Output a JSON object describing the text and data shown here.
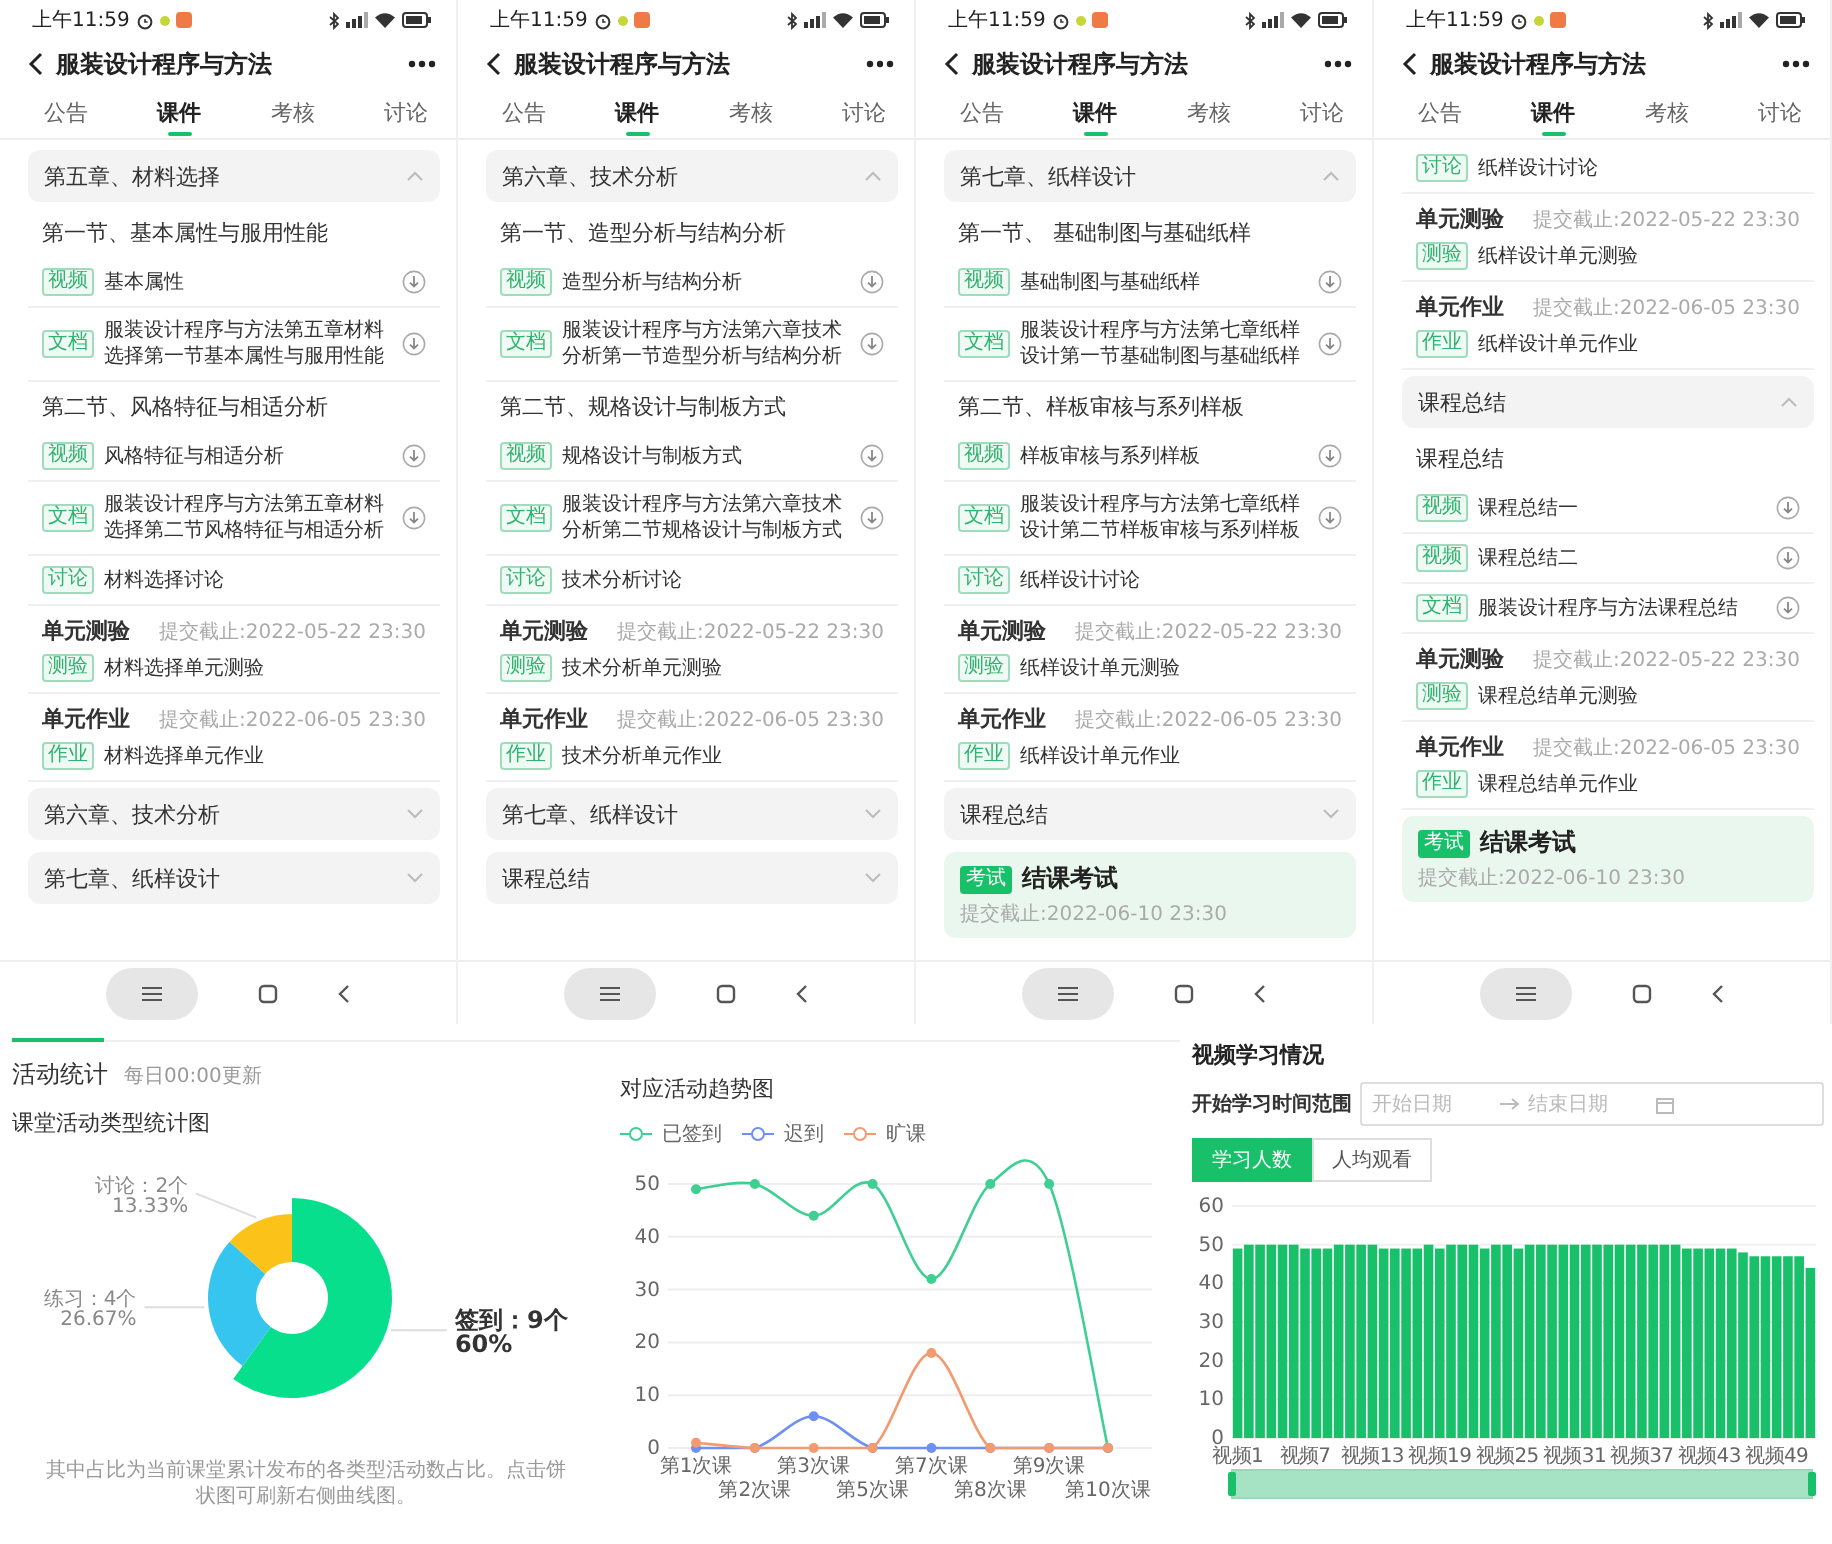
{
  "phones": [
    {
      "status_time": "上午11:59",
      "title": "服装设计程序与方法",
      "tabs": [
        {
          "label": "公告",
          "selected": false
        },
        {
          "label": "课件",
          "selected": true
        },
        {
          "label": "考核",
          "selected": false
        },
        {
          "label": "讨论",
          "selected": false
        }
      ],
      "items": [
        {
          "kind": "chapter",
          "title": "第五章、材料选择",
          "expanded": true
        },
        {
          "kind": "section",
          "title": "第一节、基本属性与服用性能"
        },
        {
          "kind": "resource",
          "tag": "视频",
          "text": "基本属性",
          "download": true
        },
        {
          "kind": "resource",
          "tag": "文档",
          "text": "服装设计程序与方法第五章材料选择第一节基本属性与服用性能",
          "download": true
        },
        {
          "kind": "section",
          "title": "第二节、风格特征与相适分析"
        },
        {
          "kind": "resource",
          "tag": "视频",
          "text": "风格特征与相适分析",
          "download": true
        },
        {
          "kind": "resource",
          "tag": "文档",
          "text": "服装设计程序与方法第五章材料选择第二节风格特征与相适分析",
          "download": true
        },
        {
          "kind": "resource",
          "tag": "讨论",
          "text": "材料选择讨论",
          "download": false
        },
        {
          "kind": "unit",
          "title": "单元测验",
          "deadline": "提交截止:2022-05-22 23:30",
          "tag": "测验",
          "text": "材料选择单元测验"
        },
        {
          "kind": "unit",
          "title": "单元作业",
          "deadline": "提交截止:2022-06-05 23:30",
          "tag": "作业",
          "text": "材料选择单元作业"
        },
        {
          "kind": "chapter",
          "title": "第六章、技术分析",
          "expanded": false
        },
        {
          "kind": "chapter",
          "title": "第七章、纸样设计",
          "expanded": false
        }
      ]
    },
    {
      "status_time": "上午11:59",
      "title": "服装设计程序与方法",
      "tabs": [
        {
          "label": "公告",
          "selected": false
        },
        {
          "label": "课件",
          "selected": true
        },
        {
          "label": "考核",
          "selected": false
        },
        {
          "label": "讨论",
          "selected": false
        }
      ],
      "items": [
        {
          "kind": "chapter",
          "title": "第六章、技术分析",
          "expanded": true
        },
        {
          "kind": "section",
          "title": "第一节、造型分析与结构分析"
        },
        {
          "kind": "resource",
          "tag": "视频",
          "text": "造型分析与结构分析",
          "download": true
        },
        {
          "kind": "resource",
          "tag": "文档",
          "text": "服装设计程序与方法第六章技术分析第一节造型分析与结构分析",
          "download": true
        },
        {
          "kind": "section",
          "title": "第二节、规格设计与制板方式"
        },
        {
          "kind": "resource",
          "tag": "视频",
          "text": "规格设计与制板方式",
          "download": true
        },
        {
          "kind": "resource",
          "tag": "文档",
          "text": "服装设计程序与方法第六章技术分析第二节规格设计与制板方式",
          "download": true
        },
        {
          "kind": "resource",
          "tag": "讨论",
          "text": "技术分析讨论",
          "download": false
        },
        {
          "kind": "unit",
          "title": "单元测验",
          "deadline": "提交截止:2022-05-22 23:30",
          "tag": "测验",
          "text": "技术分析单元测验"
        },
        {
          "kind": "unit",
          "title": "单元作业",
          "deadline": "提交截止:2022-06-05 23:30",
          "tag": "作业",
          "text": "技术分析单元作业"
        },
        {
          "kind": "chapter",
          "title": "第七章、纸样设计",
          "expanded": false
        },
        {
          "kind": "chapter",
          "title": "课程总结",
          "expanded": false
        }
      ]
    },
    {
      "status_time": "上午11:59",
      "title": "服装设计程序与方法",
      "tabs": [
        {
          "label": "公告",
          "selected": false
        },
        {
          "label": "课件",
          "selected": true
        },
        {
          "label": "考核",
          "selected": false
        },
        {
          "label": "讨论",
          "selected": false
        }
      ],
      "items": [
        {
          "kind": "chapter",
          "title": "第七章、纸样设计",
          "expanded": true
        },
        {
          "kind": "section",
          "title": "第一节、 基础制图与基础纸样"
        },
        {
          "kind": "resource",
          "tag": "视频",
          "text": "基础制图与基础纸样",
          "download": true
        },
        {
          "kind": "resource",
          "tag": "文档",
          "text": "服装设计程序与方法第七章纸样设计第一节基础制图与基础纸样",
          "download": true
        },
        {
          "kind": "section",
          "title": "第二节、样板审核与系列样板"
        },
        {
          "kind": "resource",
          "tag": "视频",
          "text": "样板审核与系列样板",
          "download": true
        },
        {
          "kind": "resource",
          "tag": "文档",
          "text": "服装设计程序与方法第七章纸样设计第二节样板审核与系列样板",
          "download": true
        },
        {
          "kind": "resource",
          "tag": "讨论",
          "text": "纸样设计讨论",
          "download": false
        },
        {
          "kind": "unit",
          "title": "单元测验",
          "deadline": "提交截止:2022-05-22 23:30",
          "tag": "测验",
          "text": "纸样设计单元测验"
        },
        {
          "kind": "unit",
          "title": "单元作业",
          "deadline": "提交截止:2022-06-05 23:30",
          "tag": "作业",
          "text": "纸样设计单元作业"
        },
        {
          "kind": "chapter",
          "title": "课程总结",
          "expanded": false
        },
        {
          "kind": "exam",
          "tag": "考试",
          "title": "结课考试",
          "deadline": "提交截止:2022-06-10 23:30"
        }
      ]
    },
    {
      "status_time": "上午11:59",
      "title": "服装设计程序与方法",
      "tabs": [
        {
          "label": "公告",
          "selected": false
        },
        {
          "label": "课件",
          "selected": true
        },
        {
          "label": "考核",
          "selected": false
        },
        {
          "label": "讨论",
          "selected": false
        }
      ],
      "items": [
        {
          "kind": "resource",
          "tag": "讨论",
          "text": "纸样设计讨论",
          "download": false
        },
        {
          "kind": "unit",
          "title": "单元测验",
          "deadline": "提交截止:2022-05-22 23:30",
          "tag": "测验",
          "text": "纸样设计单元测验"
        },
        {
          "kind": "unit",
          "title": "单元作业",
          "deadline": "提交截止:2022-06-05 23:30",
          "tag": "作业",
          "text": "纸样设计单元作业"
        },
        {
          "kind": "chapter",
          "title": "课程总结",
          "expanded": true
        },
        {
          "kind": "section",
          "title": "课程总结"
        },
        {
          "kind": "resource",
          "tag": "视频",
          "text": "课程总结一",
          "download": true
        },
        {
          "kind": "resource",
          "tag": "视频",
          "text": "课程总结二",
          "download": true
        },
        {
          "kind": "resource",
          "tag": "文档",
          "text": "服装设计程序与方法课程总结",
          "download": true
        },
        {
          "kind": "unit",
          "title": "单元测验",
          "deadline": "提交截止:2022-05-22 23:30",
          "tag": "测验",
          "text": "课程总结单元测验"
        },
        {
          "kind": "unit",
          "title": "单元作业",
          "deadline": "提交截止:2022-06-05 23:30",
          "tag": "作业",
          "text": "课程总结单元作业"
        },
        {
          "kind": "exam",
          "tag": "考试",
          "title": "结课考试",
          "deadline": "提交截止:2022-06-10 23:30"
        }
      ]
    }
  ],
  "activity_stats": {
    "title": "活动统计",
    "update_note": "每日00:00更新",
    "chart_title": "课堂活动类型统计图",
    "slices": [
      {
        "label": "签到：9个",
        "percent": "60%",
        "selected": true
      },
      {
        "label": "练习：4个",
        "percent": "26.67%",
        "selected": false
      },
      {
        "label": "讨论：2个",
        "percent": "13.33%",
        "selected": false
      }
    ],
    "chart_data": {
      "type": "donut",
      "values": [
        60,
        26.67,
        13.33
      ]
    },
    "footnote": "其中占比为当前课堂累计发布的各类型活动数占比。点击饼状图可刷新右侧曲线图。"
  },
  "trend": {
    "title": "对应活动趋势图",
    "chart_data": {
      "type": "line",
      "categories": [
        "第1次课",
        "第2次课",
        "第3次课",
        "第5次课",
        "第7次课",
        "第8次课",
        "第9次课",
        "第10次课"
      ],
      "yticks": [
        0,
        10,
        20,
        30,
        40,
        50
      ],
      "ylim": [
        0,
        50
      ],
      "grid": true,
      "series": [
        {
          "name": "已签到",
          "color": "#3fcf93",
          "marker": "circle",
          "values": [
            49,
            50,
            44,
            50,
            32,
            50,
            50,
            0
          ]
        },
        {
          "name": "迟到",
          "color": "#6f8ff2",
          "marker": "circle",
          "values": [
            0,
            0,
            6,
            0,
            0,
            0,
            0,
            0
          ]
        },
        {
          "name": "旷课",
          "color": "#f39a70",
          "marker": "circle",
          "values": [
            1,
            0,
            0,
            0,
            18,
            0,
            0,
            0
          ]
        }
      ]
    }
  },
  "video": {
    "title": "视频学习情况",
    "range_label": "开始学习时间范围",
    "start_placeholder": "开始日期",
    "end_placeholder": "结束日期",
    "toggles": [
      {
        "label": "学习人数",
        "selected": true
      },
      {
        "label": "人均观看",
        "selected": false
      }
    ],
    "chart_data": {
      "type": "bar",
      "ylim": [
        0,
        60
      ],
      "yticks": [
        0,
        10,
        20,
        30,
        40,
        50,
        60
      ],
      "grid": true,
      "categories": [
        "视频1",
        null,
        null,
        null,
        null,
        null,
        "视频7",
        null,
        null,
        null,
        null,
        null,
        "视频13",
        null,
        null,
        null,
        null,
        null,
        "视频19",
        null,
        null,
        null,
        null,
        null,
        "视频25",
        null,
        null,
        null,
        null,
        null,
        "视频31",
        null,
        null,
        null,
        null,
        null,
        "视频37",
        null,
        null,
        null,
        null,
        null,
        "视频43",
        null,
        null,
        null,
        null,
        null,
        "视频49",
        null,
        null,
        null
      ],
      "series": [
        {
          "color": "#19c06a",
          "values": [
            49,
            50,
            50,
            50,
            50,
            50,
            49,
            49,
            49,
            50,
            50,
            50,
            50,
            49,
            49,
            49,
            49,
            50,
            49,
            50,
            50,
            50,
            49,
            50,
            50,
            49,
            50,
            50,
            50,
            50,
            50,
            50,
            50,
            50,
            50,
            50,
            50,
            50,
            50,
            50,
            49,
            49,
            49,
            49,
            49,
            48,
            47,
            47,
            47,
            47,
            47,
            44
          ]
        }
      ]
    }
  }
}
